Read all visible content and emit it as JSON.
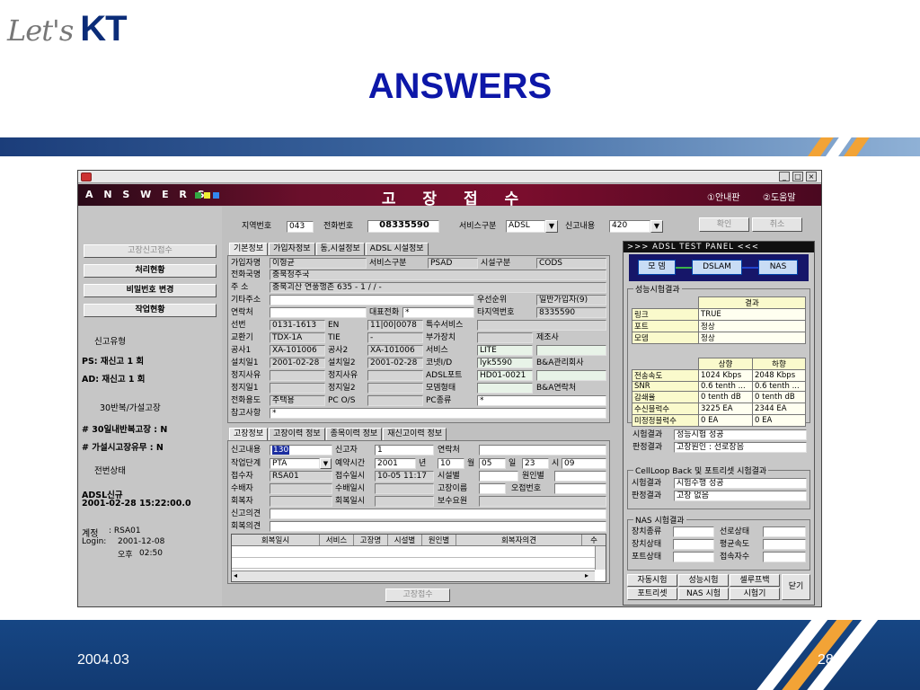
{
  "slide": {
    "logo_lets": "Let's",
    "logo_kt": "KT",
    "title": "ANSWERS",
    "footer_date": "2004.03",
    "footer_page": "28"
  },
  "app": {
    "brand": "A N S W E R S",
    "screen_title": "고 장 접 수",
    "header_links": [
      "①안내판",
      "②도움말"
    ],
    "window_buttons": [
      "_",
      "□",
      "×"
    ],
    "search": {
      "area_code_label": "지역번호",
      "area_code_value": "043",
      "phone_label": "전화번호",
      "phone_value": "08335590",
      "service_label": "서비스구분",
      "service_value": "ADSL",
      "report_label": "신고내용",
      "report_value": "420",
      "confirm_button": "확인",
      "cancel_button": "취소"
    },
    "left_panel": {
      "buttons": [
        "고장신고접수",
        "처리현황",
        "비밀번호 변경",
        "작업현황"
      ],
      "report_type_label": "신고유형",
      "ps_line": "PS: 재신고 1 회",
      "ad_line": "AD: 재신고 1 회",
      "repeat_label": "30반복/가설고장",
      "repeat_line1": "# 30일내반복고장 : N",
      "repeat_line2": "# 가설시고장유무 : N",
      "prev_status_label": "전번상태",
      "new_status": "ADSL신규",
      "new_datetime": "2001-02-28 15:22:00.0",
      "account_label": "계정",
      "account_value": ": RSA01",
      "login_label": "Login:",
      "login_date": "2001-12-08",
      "login_time_label": "오후",
      "login_time": "02:50"
    },
    "upper_tabs": [
      "기본정보",
      "가입자정보",
      "동,시설정보",
      "ADSL 시설정보"
    ],
    "basic": {
      "subscriber_name_label": "가입자명",
      "subscriber_name": "이형균",
      "service_type_label": "서비스구분",
      "service_type": "PSAD",
      "facility_type_label": "시설구분",
      "facility_type": "CODS",
      "phone_station_label": "전화국명",
      "phone_station": "충북청주국",
      "address_label": "주 소",
      "address": "충북괴산 연풍행촌 635 - 1 / / -",
      "other_address_label": "기타주소",
      "priority_label": "우선순위",
      "priority": "일반가입자(9)",
      "contact_label": "연락처",
      "main_phone_label": "대표전화",
      "main_phone": "*",
      "other_area_phone_label": "타지역번호",
      "other_area_phone": "8335590",
      "line_no_label": "선번",
      "line_no": "0131-1613",
      "en_label": "EN",
      "en_value": "11|00|0078",
      "special_service_label": "특수서비스",
      "exchange_label": "교환기",
      "exchange": "TDX-1A",
      "tie_label": "TIE",
      "tie_value": "-",
      "extra_device_label": "부가장치",
      "manufacturer_label": "제조사",
      "construction1_label": "공사1",
      "construction1": "XA-101006",
      "construction2_label": "공사2",
      "construction2": "XA-101006",
      "service_label": "서비스",
      "service_value": "LITE",
      "install1_label": "설치일1",
      "install1": "2001-02-28",
      "install2_label": "설치일2",
      "install2": "2001-02-28",
      "konet_id_label": "코넷I/D",
      "konet_id": "lyk5590",
      "ba_company_label": "B&A관리회사",
      "stop_reason1_label": "정지사유",
      "stop_reason2_label": "정지사유",
      "adsl_port_label": "ADSL포트",
      "adsl_port": "HD01-0021",
      "stop_date1_label": "정지일1",
      "stop_date2_label": "정지일2",
      "modem_type_label": "모뎀형태",
      "ba_contact_label": "B&A연락처",
      "phone_usage_label": "전화용도",
      "phone_usage": "주택용",
      "pc_os_label": "PC O/S",
      "pc_type_label": "PC종류",
      "pc_type": "*",
      "reference_label": "참고사항",
      "reference": "*"
    },
    "lower_tabs": [
      "고장정보",
      "고장이력 정보",
      "종목이력 정보",
      "재신고이력 정보"
    ],
    "trouble": {
      "report_content_label": "신고내용",
      "report_content": "130",
      "reporter_label": "신고자",
      "reporter": "1",
      "contact_label": "연락처",
      "work_stage_label": "작업단계",
      "work_stage": "PTA",
      "reserve_time_label": "예약시간",
      "year": "2001",
      "year_unit": "년",
      "month": "10",
      "month_unit": "월",
      "month_val": "05",
      "day_unit": "일",
      "day": "23",
      "hour_unit": "시",
      "hour": "09",
      "receiver_label": "접수자",
      "receiver": "RSA01",
      "receive_time_label": "접수일시",
      "receive_time": "10-05 11:17",
      "facility_label": "시설별",
      "cause_label": "원인별",
      "repairer_label": "수배자",
      "repair_time_label": "수배일시",
      "trouble_name_label": "고장이름",
      "operator_no_label": "오접번호",
      "restorer_label": "회복자",
      "restore_time_label": "회복일시",
      "maintenance_label": "보수요원",
      "report_opinion_label": "신고의견",
      "restore_opinion_label": "회복의견",
      "grid_headers": [
        "회복일시",
        "서비스",
        "고장명",
        "시설별",
        "원인별",
        "회복자의견",
        "수"
      ],
      "submit_button": "고장접수"
    },
    "adsl": {
      "panel_title": ">>> ADSL TEST PANEL <<<",
      "modem": "모 뎀",
      "dslam": "DSLAM",
      "nas": "NAS",
      "perf_title": "성능시험결과",
      "result_header": "결과",
      "link_label": "링크",
      "link_value": "TRUE",
      "port_label": "포트",
      "port_value": "정상",
      "modem_label": "모뎀",
      "modem_value": "정상",
      "up_header": "상향",
      "down_header": "하향",
      "rate_label": "전송속도",
      "rate_up": "1024 Kbps",
      "rate_down": "2048 Kbps",
      "snr_label": "SNR",
      "snr_up": "0.6 tenth ...",
      "snr_down": "0.6 tenth ...",
      "atten_label": "감쇄율",
      "atten_up": "0 tenth dB",
      "atten_down": "0 tenth dB",
      "rx_label": "수신블럭수",
      "rx_up": "3225 EA",
      "rx_down": "2344 EA",
      "uncorr_label": "미정정블럭수",
      "uncorr_up": "0 EA",
      "uncorr_down": "0 EA",
      "test_result_label": "시험결과",
      "test_result": "성능시험 성공",
      "judge_label": "판정결과",
      "judge": "고장원인 : 선로장음",
      "cellloop_title": "CellLoop Back 및 포트리셋 시험결과",
      "cl_test_label": "시험결과",
      "cl_test": "시험수행 성공",
      "cl_judge_label": "판정결과",
      "cl_judge": "고장 없음",
      "nas_title": "NAS 시험결과",
      "device_type_label": "장치종류",
      "line_status_label": "선로상태",
      "device_status_label": "장치상태",
      "avg_speed_label": "평균속도",
      "port_status_label": "포트상태",
      "connections_label": "접속자수",
      "buttons": [
        "자동시험",
        "성능시험",
        "셀루프백",
        "포트리셋",
        "NAS 시험",
        "시험기",
        "닫기"
      ]
    }
  }
}
